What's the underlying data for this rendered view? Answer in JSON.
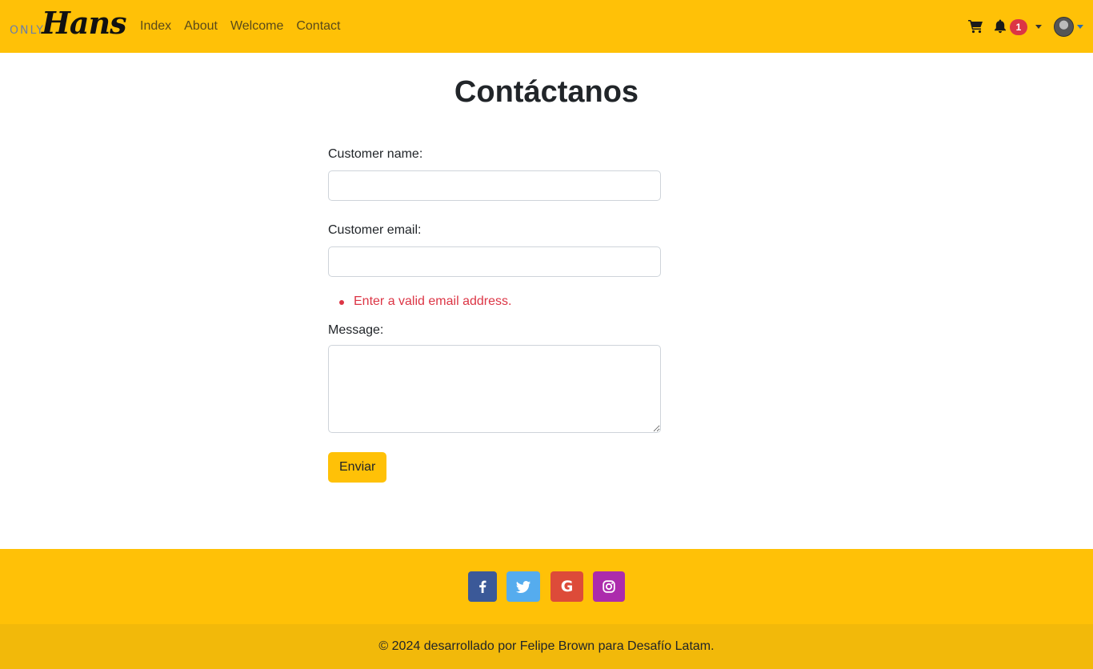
{
  "navbar": {
    "brand_small": "ONLY",
    "brand_main": "Hans",
    "links": [
      "Index",
      "About",
      "Welcome",
      "Contact"
    ],
    "notifications_count": "1",
    "icons": [
      "shopping-cart-icon",
      "bell-icon",
      "avatar"
    ],
    "colors": {
      "background": "#ffc107",
      "badge": "#dc3545"
    }
  },
  "main": {
    "title": "Contáctanos",
    "fields": {
      "name_label": "Customer name:",
      "name_value": "",
      "email_label": "Customer email:",
      "email_value": "",
      "message_label": "Message:",
      "message_value": ""
    },
    "errors": [
      "Enter a valid email address."
    ],
    "submit_label": "Enviar"
  },
  "footer": {
    "social": [
      {
        "name": "facebook",
        "glyph": "f",
        "color": "#3b5998"
      },
      {
        "name": "twitter",
        "glyph": "twitter",
        "color": "#55acee"
      },
      {
        "name": "google",
        "glyph": "G",
        "color": "#dd4b39"
      },
      {
        "name": "instagram",
        "glyph": "instagram",
        "color": "#ac2bac"
      }
    ],
    "copyright": "© 2024 desarrollado por Felipe Brown para Desafío Latam."
  }
}
